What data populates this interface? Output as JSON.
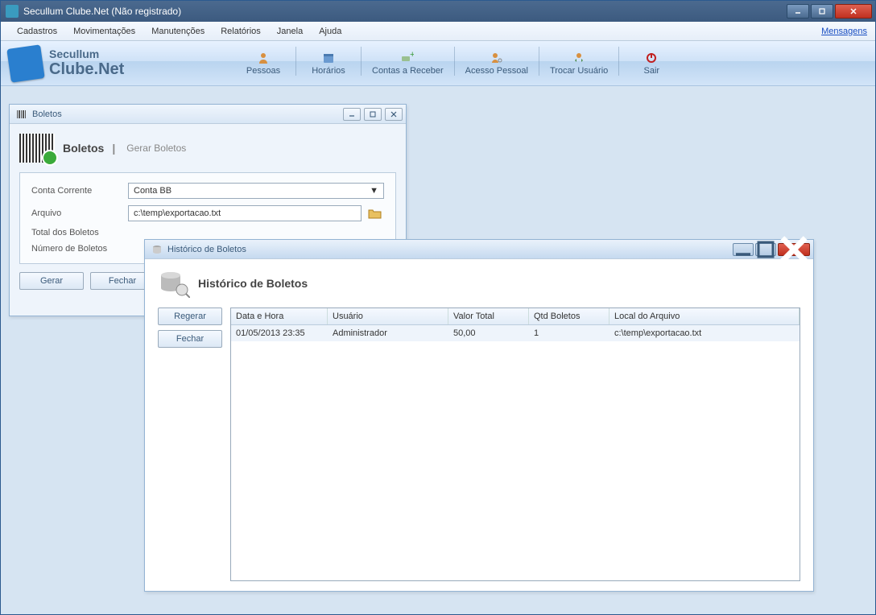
{
  "window": {
    "title": "Secullum Clube.Net (Não registrado)"
  },
  "menubar": {
    "items": [
      "Cadastros",
      "Movimentações",
      "Manutenções",
      "Relatórios",
      "Janela",
      "Ajuda"
    ],
    "messages": "Mensagens"
  },
  "brand": {
    "line1": "Secullum",
    "line2": "Clube.Net"
  },
  "toolbar": {
    "pessoas": "Pessoas",
    "horarios": "Horários",
    "contas": "Contas a Receber",
    "acesso": "Acesso Pessoal",
    "trocar": "Trocar Usuário",
    "sair": "Sair"
  },
  "boletos": {
    "window_title": "Boletos",
    "section_title": "Boletos",
    "section_sub": "Gerar Boletos",
    "conta_label": "Conta Corrente",
    "conta_value": "Conta BB",
    "arquivo_label": "Arquivo",
    "arquivo_value": "c:\\temp\\exportacao.txt",
    "total_label": "Total dos Boletos",
    "numero_label": "Número de Boletos",
    "btn_gerar": "Gerar",
    "btn_fechar": "Fechar"
  },
  "historico": {
    "window_title": "Histórico de Boletos",
    "section_title": "Histórico de Boletos",
    "btn_regerar": "Regerar",
    "btn_fechar": "Fechar",
    "columns": {
      "data": "Data e Hora",
      "usuario": "Usuário",
      "valor": "Valor Total",
      "qtd": "Qtd Boletos",
      "local": "Local do Arquivo"
    },
    "rows": [
      {
        "data": "01/05/2013 23:35",
        "usuario": "Administrador",
        "valor": "50,00",
        "qtd": "1",
        "local": "c:\\temp\\exportacao.txt"
      }
    ]
  }
}
